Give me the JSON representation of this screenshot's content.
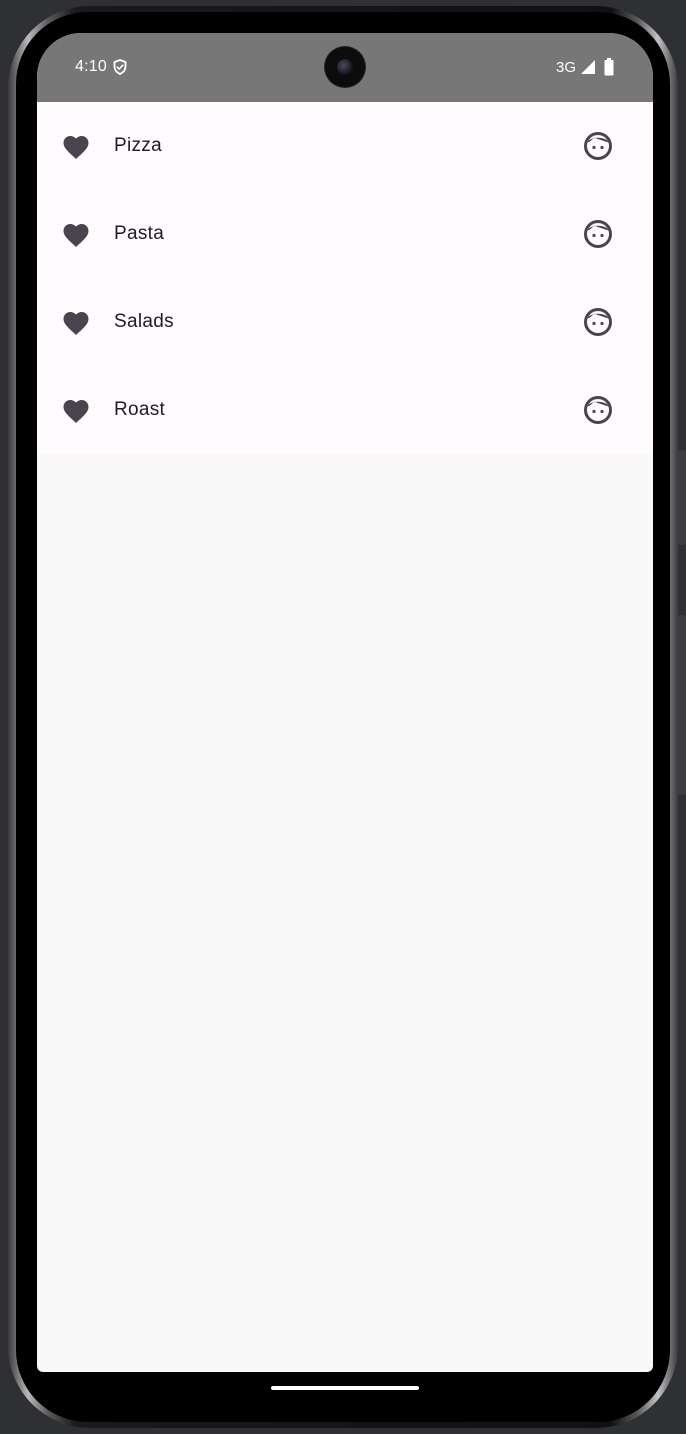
{
  "status_bar": {
    "time": "4:10",
    "network": "3G",
    "icons": [
      "shield-icon",
      "signal-icon",
      "battery-icon"
    ]
  },
  "list": {
    "items": [
      {
        "label": "Pizza",
        "leading_icon": "heart-icon",
        "trailing_icon": "face-icon"
      },
      {
        "label": "Pasta",
        "leading_icon": "heart-icon",
        "trailing_icon": "face-icon"
      },
      {
        "label": "Salads",
        "leading_icon": "heart-icon",
        "trailing_icon": "face-icon"
      },
      {
        "label": "Roast",
        "leading_icon": "heart-icon",
        "trailing_icon": "face-icon"
      }
    ]
  },
  "colors": {
    "status_bar": "#777777",
    "list_background": "#fffbfe",
    "page_background": "#f9f9f9",
    "icon": "#49454f",
    "text": "#1f1b22"
  }
}
